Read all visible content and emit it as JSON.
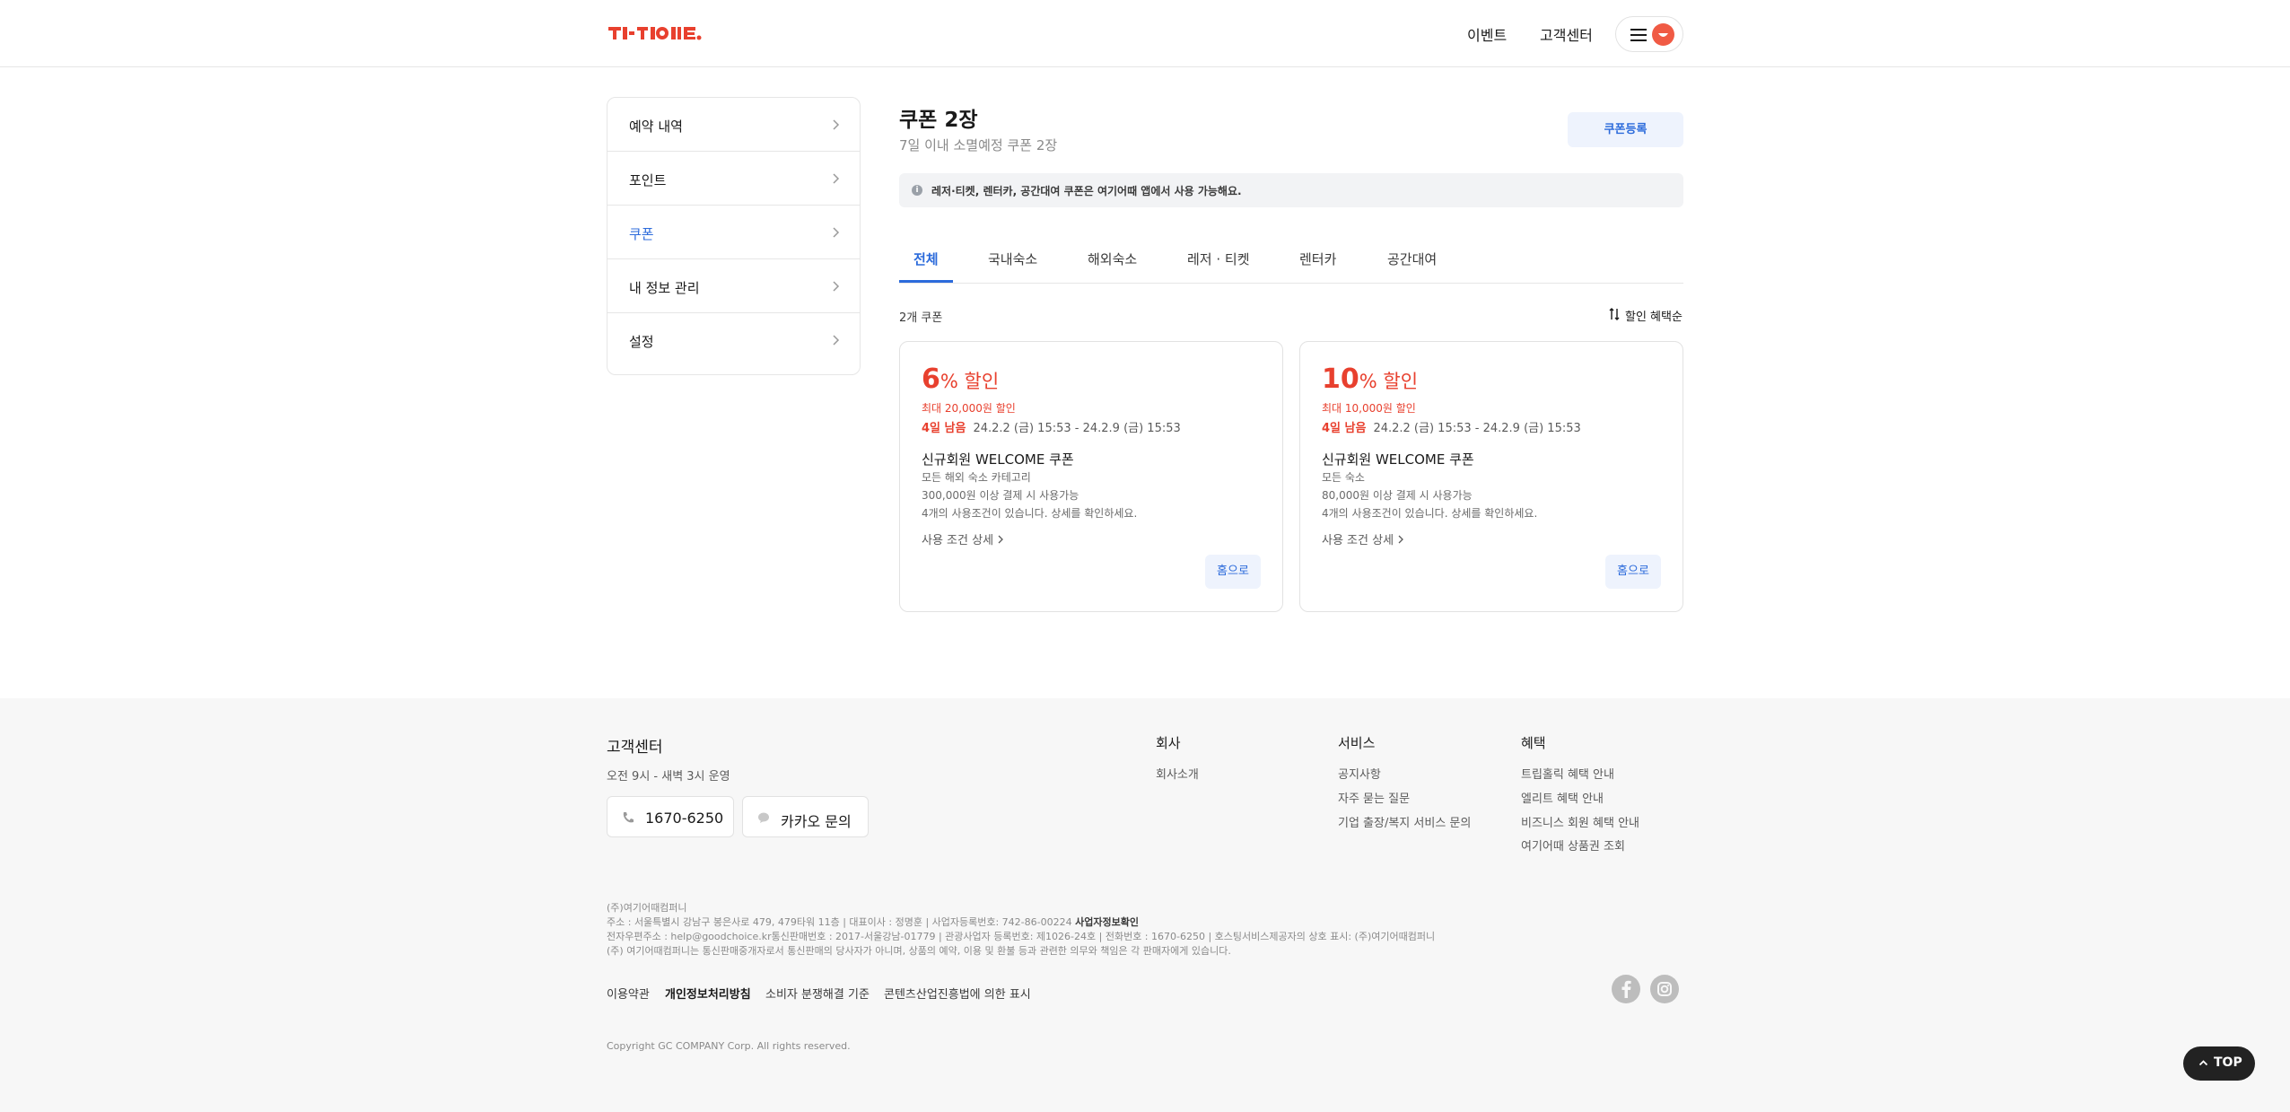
{
  "header": {
    "logo_text": "여기어때",
    "nav": [
      "이벤트",
      "고객센터"
    ],
    "brand_color": "#e8402e"
  },
  "sidebar": {
    "items": [
      {
        "label": "예약 내역",
        "active": false
      },
      {
        "label": "포인트",
        "active": false
      },
      {
        "label": "쿠폰",
        "active": true
      },
      {
        "label": "내 정보 관리",
        "active": false
      },
      {
        "label": "설정",
        "active": false
      }
    ]
  },
  "main": {
    "title": "쿠폰 2장",
    "subtitle": "7일 이내 소멸예정 쿠폰 2장",
    "register_label": "쿠폰등록",
    "notice": "레저·티켓, 렌터카, 공간대여 쿠폰은 여기어때 앱에서 사용 가능해요.",
    "tabs": [
      "전체",
      "국내숙소",
      "해외숙소",
      "레저 · 티켓",
      "렌터카",
      "공간대여"
    ],
    "active_tab": "전체",
    "count": "2개 쿠폰",
    "sort_label": "할인 혜택순"
  },
  "coupons": [
    {
      "num": "6",
      "unit": "% 할인",
      "max": "최대 20,000원 할인",
      "days_left": "4일 남음",
      "period": "24.2.2 (금) 15:53 - 24.2.9 (금) 15:53",
      "name": "신규회원 WELCOME 쿠폰",
      "lines": [
        "모든 해외 숙소 카테고리",
        "300,000원 이상 결제 시 사용가능",
        "4개의 사용조건이 있습니다. 상세를 확인하세요."
      ],
      "detail": "사용 조건 상세",
      "go": "홈으로"
    },
    {
      "num": "10",
      "unit": "% 할인",
      "max": "최대 10,000원 할인",
      "days_left": "4일 남음",
      "period": "24.2.2 (금) 15:53 - 24.2.9 (금) 15:53",
      "name": "신규회원 WELCOME 쿠폰",
      "lines": [
        "모든 숙소",
        "80,000원 이상 결제 시 사용가능",
        "4개의 사용조건이 있습니다. 상세를 확인하세요."
      ],
      "detail": "사용 조건 상세",
      "go": "홈으로"
    }
  ],
  "footer": {
    "cs_title": "고객센터",
    "cs_hours": "오전 9시 - 새벽 3시 운영",
    "phone": "1670-6250",
    "kakao": "카카오 문의",
    "columns": [
      {
        "title": "회사",
        "links": [
          "회사소개"
        ]
      },
      {
        "title": "서비스",
        "links": [
          "공지사항",
          "자주 묻는 질문",
          "기업 출장/복지 서비스 문의"
        ]
      },
      {
        "title": "혜택",
        "links": [
          "트립홀릭 혜택 안내",
          "엘리트 혜택 안내",
          "비즈니스 회원 혜택 안내",
          "여기어때 상품권 조회"
        ]
      }
    ],
    "info": [
      "(주)여기어때컴퍼니",
      "주소 : 서울특별시 강남구 봉은사로 479, 479타워 11층 | 대표이사 : 정명훈 | 사업자등록번호: 742-86-00224",
      "사업자정보확인",
      "전자우편주소 : help@goodchoice.kr통신판매번호 : 2017-서울강남-01779 | 관광사업자 등록번호: 제1026-24호 | 전화번호 : 1670-6250 | 호스팅서비스제공자의 상호 표시: (주)여기어때컴퍼니",
      "(주) 여기어때컴퍼니는 통신판매중개자로서 통신판매의 당사자가 아니며, 상품의 예약, 이용 및 환불 등과 관련한 의무와 책임은 각 판매자에게 있습니다."
    ],
    "bottom_links": [
      "이용약관",
      "개인정보처리방침",
      "소비자 분쟁해결 기준",
      "콘텐츠산업진흥법에 의한 표시"
    ],
    "copyright": "Copyright GC COMPANY Corp. All rights reserved.",
    "top_label": "TOP"
  }
}
